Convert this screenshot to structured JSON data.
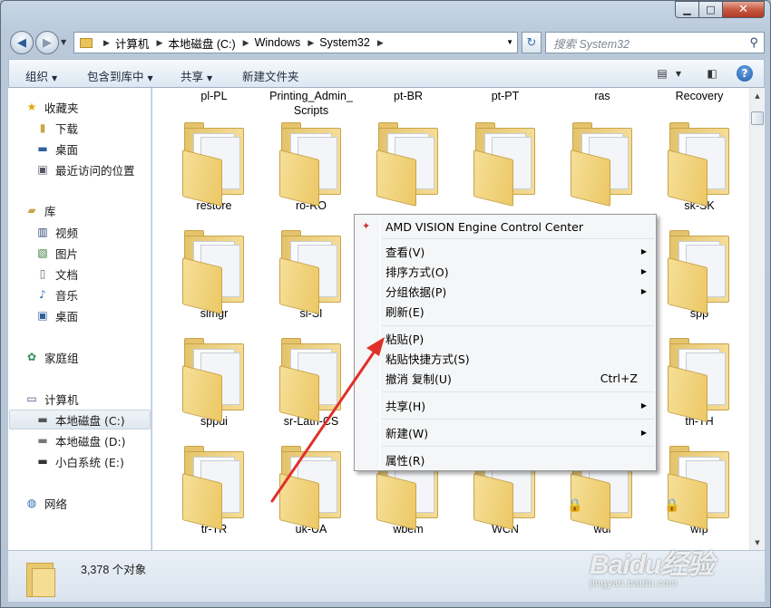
{
  "address": {
    "crumbs": [
      "计算机",
      "本地磁盘 (C:)",
      "Windows",
      "System32"
    ]
  },
  "search": {
    "placeholder": "搜索 System32"
  },
  "toolbar": {
    "organize": "组织",
    "include_in_library": "包含到库中",
    "share": "共享",
    "new_folder": "新建文件夹"
  },
  "nav": {
    "favorites": "收藏夹",
    "downloads": "下载",
    "desktop": "桌面",
    "recent": "最近访问的位置",
    "libraries": "库",
    "videos": "视频",
    "pictures": "图片",
    "documents": "文档",
    "music": "音乐",
    "lib_desktop": "桌面",
    "homegroup": "家庭组",
    "computer": "计算机",
    "drive_c": "本地磁盘 (C:)",
    "drive_d": "本地磁盘 (D:)",
    "drive_e": "小白系统 (E:)",
    "network": "网络"
  },
  "top_labels": [
    "pl-PL",
    "Printing_Admin_\nScripts",
    "pt-BR",
    "pt-PT",
    "ras",
    "Recovery"
  ],
  "rows": [
    [
      "restore",
      "ro-RO",
      "",
      "",
      "",
      "sk-SK"
    ],
    [
      "slmgr",
      "sl-SI",
      "",
      "",
      "",
      "spp"
    ],
    [
      "sppui",
      "sr-Latn-CS",
      "",
      "",
      "",
      "th-TH"
    ],
    [
      "tr-TR",
      "uk-UA",
      "wbem",
      "WCN",
      "wdi",
      "wfp"
    ]
  ],
  "menu": {
    "amd": "AMD VISION Engine Control Center",
    "view": "查看(V)",
    "sort": "排序方式(O)",
    "group": "分组依据(P)",
    "refresh": "刷新(E)",
    "paste": "粘贴(P)",
    "paste_shortcut": "粘贴快捷方式(S)",
    "undo": "撤消 复制(U)",
    "undo_shortcut": "Ctrl+Z",
    "share": "共享(H)",
    "new": "新建(W)",
    "properties": "属性(R)"
  },
  "status": {
    "count": "3,378 个对象"
  },
  "watermark": {
    "brand": "Baidu经验",
    "url": "jingyan.baidu.com"
  },
  "colors": {
    "arrow": "#e0302a",
    "folder": "#e8c96f",
    "accent": "#1e5aa6"
  }
}
